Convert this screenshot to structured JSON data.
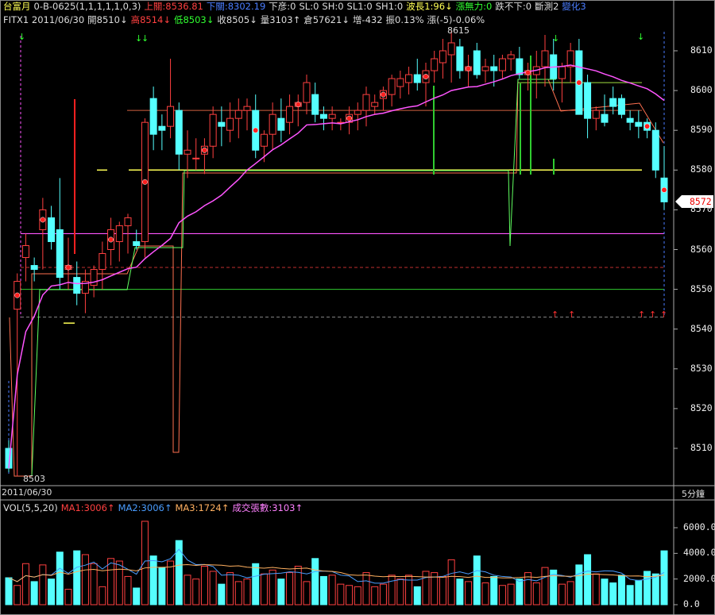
{
  "header": {
    "row1": [
      {
        "text": "台富月",
        "color": "#ffff55"
      },
      {
        "text": "0-B-0625(1,1,1,1,1,0,3)",
        "color": "#dddddd"
      },
      {
        "text": "上關:8536.81",
        "color": "#ff4040"
      },
      {
        "text": "下關:8302.19",
        "color": "#4a7dff"
      },
      {
        "text": "下彦:0",
        "color": "#dddddd"
      },
      {
        "text": "SL:0",
        "color": "#dddddd"
      },
      {
        "text": "SH:0",
        "color": "#dddddd"
      },
      {
        "text": "SL1:0",
        "color": "#dddddd"
      },
      {
        "text": "SH1:0",
        "color": "#dddddd"
      },
      {
        "text": "波長1:96↓",
        "color": "#ffff55"
      },
      {
        "text": "漲無力:0",
        "color": "#30ff30"
      },
      {
        "text": "跌不下:0",
        "color": "#dddddd"
      },
      {
        "text": "斷測2",
        "color": "#dddddd"
      },
      {
        "text": "變化3",
        "color": "#4a7dff"
      }
    ],
    "row2": [
      {
        "text": "FITX1 2011/06/30",
        "color": "#dddddd"
      },
      {
        "text": "開8510↓",
        "color": "#dddddd"
      },
      {
        "text": "高8514↓",
        "color": "#ff4040"
      },
      {
        "text": "低8503↓",
        "color": "#30ff30"
      },
      {
        "text": "收8505↓",
        "color": "#dddddd"
      },
      {
        "text": "量3103↑",
        "color": "#dddddd"
      },
      {
        "text": "倉57621↓",
        "color": "#dddddd"
      },
      {
        "text": "增-432",
        "color": "#dddddd"
      },
      {
        "text": "振0.13%",
        "color": "#dddddd"
      },
      {
        "text": "漲(-5)-0.06%",
        "color": "#dddddd"
      }
    ]
  },
  "date_label": "2011/06/30",
  "timeframe_label": "5分鐘",
  "last_price_label": "8572",
  "annotations": {
    "high": "8615",
    "low": "8503"
  },
  "volume_header": [
    {
      "text": "VOL(5,5,20)",
      "color": "#dddddd"
    },
    {
      "text": "MA1:3006↑",
      "color": "#ff4040"
    },
    {
      "text": "MA2:3006↑",
      "color": "#4a9dff"
    },
    {
      "text": "MA3:1724↑",
      "color": "#ffb060"
    },
    {
      "text": "成交張數:3103↑",
      "color": "#ff80ff"
    }
  ],
  "chart_data": {
    "type": "candlestick",
    "price_axis": {
      "min": 8503,
      "max": 8615,
      "ticks": [
        8510,
        8520,
        8530,
        8540,
        8550,
        8560,
        8570,
        8580,
        8590,
        8600,
        8610
      ]
    },
    "volume_axis": {
      "max": 6000,
      "ticks": [
        "0.0",
        "2000.0",
        "4000.0",
        "6000.0"
      ]
    },
    "candles": [
      {
        "o": 8510,
        "h": 8512,
        "l": 8504,
        "c": 8505,
        "v": 2100
      },
      {
        "o": 8545,
        "h": 8554,
        "l": 8503,
        "c": 8552,
        "v": 1500
      },
      {
        "o": 8558,
        "h": 8564,
        "l": 8552,
        "c": 8561,
        "v": 3200
      },
      {
        "o": 8556,
        "h": 8558,
        "l": 8552,
        "c": 8555,
        "v": 1800
      },
      {
        "o": 8565,
        "h": 8573,
        "l": 8555,
        "c": 8570,
        "v": 3100
      },
      {
        "o": 8568,
        "h": 8571,
        "l": 8560,
        "c": 8562,
        "v": 2000
      },
      {
        "o": 8565,
        "h": 8578,
        "l": 8550,
        "c": 8553,
        "v": 4100
      },
      {
        "o": 8555,
        "h": 8563,
        "l": 8550,
        "c": 8556,
        "v": 1200
      },
      {
        "o": 8553,
        "h": 8557,
        "l": 8546,
        "c": 8549,
        "v": 4200
      },
      {
        "o": 8549,
        "h": 8555,
        "l": 8544,
        "c": 8552,
        "v": 3900
      },
      {
        "o": 8551,
        "h": 8556,
        "l": 8548,
        "c": 8555,
        "v": 3200
      },
      {
        "o": 8555,
        "h": 8562,
        "l": 8550,
        "c": 8559,
        "v": 1400
      },
      {
        "o": 8560,
        "h": 8568,
        "l": 8556,
        "c": 8565,
        "v": 3600
      },
      {
        "o": 8562,
        "h": 8567,
        "l": 8557,
        "c": 8566,
        "v": 3400
      },
      {
        "o": 8566,
        "h": 8569,
        "l": 8559,
        "c": 8568,
        "v": 2200
      },
      {
        "o": 8562,
        "h": 8565,
        "l": 8560,
        "c": 8561,
        "v": 1300
      },
      {
        "o": 8562,
        "h": 8593,
        "l": 8558,
        "c": 8592,
        "v": 6500
      },
      {
        "o": 8598,
        "h": 8601,
        "l": 8585,
        "c": 8589,
        "v": 3800
      },
      {
        "o": 8591,
        "h": 8594,
        "l": 8585,
        "c": 8590,
        "v": 2900
      },
      {
        "o": 8591,
        "h": 8608,
        "l": 8588,
        "c": 8596,
        "v": 3400
      },
      {
        "o": 8595,
        "h": 8597,
        "l": 8580,
        "c": 8584,
        "v": 5000
      },
      {
        "o": 8584,
        "h": 8590,
        "l": 8578,
        "c": 8585,
        "v": 2300
      },
      {
        "o": 8583,
        "h": 8588,
        "l": 8580,
        "c": 8583,
        "v": 2000
      },
      {
        "o": 8584,
        "h": 8588,
        "l": 8579,
        "c": 8586,
        "v": 3000
      },
      {
        "o": 8586,
        "h": 8596,
        "l": 8583,
        "c": 8594,
        "v": 2600
      },
      {
        "o": 8592,
        "h": 8596,
        "l": 8586,
        "c": 8591,
        "v": 1600
      },
      {
        "o": 8590,
        "h": 8597,
        "l": 8587,
        "c": 8593,
        "v": 2500
      },
      {
        "o": 8593,
        "h": 8598,
        "l": 8588,
        "c": 8595,
        "v": 1800
      },
      {
        "o": 8595,
        "h": 8598,
        "l": 8590,
        "c": 8596,
        "v": 2000
      },
      {
        "o": 8595,
        "h": 8599,
        "l": 8583,
        "c": 8585,
        "v": 3200
      },
      {
        "o": 8586,
        "h": 8590,
        "l": 8582,
        "c": 8589,
        "v": 2400
      },
      {
        "o": 8589,
        "h": 8597,
        "l": 8585,
        "c": 8594,
        "v": 2700
      },
      {
        "o": 8593,
        "h": 8598,
        "l": 8587,
        "c": 8590,
        "v": 2000
      },
      {
        "o": 8592,
        "h": 8599,
        "l": 8589,
        "c": 8596,
        "v": 2500
      },
      {
        "o": 8596,
        "h": 8599,
        "l": 8591,
        "c": 8597,
        "v": 3000
      },
      {
        "o": 8597,
        "h": 8604,
        "l": 8594,
        "c": 8602,
        "v": 1800
      },
      {
        "o": 8599,
        "h": 8602,
        "l": 8592,
        "c": 8594,
        "v": 3600
      },
      {
        "o": 8594,
        "h": 8596,
        "l": 8590,
        "c": 8593,
        "v": 2200
      },
      {
        "o": 8593,
        "h": 8596,
        "l": 8590,
        "c": 8594,
        "v": 2300
      },
      {
        "o": 8592,
        "h": 8593,
        "l": 8590,
        "c": 8592,
        "v": 1600
      },
      {
        "o": 8592,
        "h": 8596,
        "l": 8589,
        "c": 8594,
        "v": 1500
      },
      {
        "o": 8594,
        "h": 8597,
        "l": 8590,
        "c": 8595,
        "v": 1400
      },
      {
        "o": 8595,
        "h": 8601,
        "l": 8591,
        "c": 8599,
        "v": 2500
      },
      {
        "o": 8596,
        "h": 8599,
        "l": 8594,
        "c": 8597,
        "v": 1400
      },
      {
        "o": 8598,
        "h": 8601,
        "l": 8595,
        "c": 8600,
        "v": 1600
      },
      {
        "o": 8599,
        "h": 8604,
        "l": 8596,
        "c": 8603,
        "v": 2300
      },
      {
        "o": 8601,
        "h": 8605,
        "l": 8598,
        "c": 8603,
        "v": 2000
      },
      {
        "o": 8602,
        "h": 8606,
        "l": 8599,
        "c": 8604,
        "v": 2300
      },
      {
        "o": 8604,
        "h": 8608,
        "l": 8600,
        "c": 8602,
        "v": 1400
      },
      {
        "o": 8602,
        "h": 8607,
        "l": 8596,
        "c": 8605,
        "v": 2600
      },
      {
        "o": 8605,
        "h": 8610,
        "l": 8602,
        "c": 8608,
        "v": 2500
      },
      {
        "o": 8607,
        "h": 8613,
        "l": 8603,
        "c": 8610,
        "v": 2200
      },
      {
        "o": 8609,
        "h": 8615,
        "l": 8602,
        "c": 8612,
        "v": 3500
      },
      {
        "o": 8611,
        "h": 8613,
        "l": 8603,
        "c": 8605,
        "v": 2000
      },
      {
        "o": 8605,
        "h": 8609,
        "l": 8601,
        "c": 8606,
        "v": 1800
      },
      {
        "o": 8610,
        "h": 8612,
        "l": 8603,
        "c": 8604,
        "v": 3800
      },
      {
        "o": 8605,
        "h": 8608,
        "l": 8602,
        "c": 8606,
        "v": 1700
      },
      {
        "o": 8606,
        "h": 8609,
        "l": 8601,
        "c": 8605,
        "v": 2200
      },
      {
        "o": 8605,
        "h": 8609,
        "l": 8603,
        "c": 8608,
        "v": 1500
      },
      {
        "o": 8608,
        "h": 8610,
        "l": 8605,
        "c": 8609,
        "v": 1600
      },
      {
        "o": 8608,
        "h": 8611,
        "l": 8603,
        "c": 8604,
        "v": 2000
      },
      {
        "o": 8604,
        "h": 8607,
        "l": 8600,
        "c": 8605,
        "v": 2500
      },
      {
        "o": 8604,
        "h": 8610,
        "l": 8598,
        "c": 8606,
        "v": 1700
      },
      {
        "o": 8606,
        "h": 8614,
        "l": 8601,
        "c": 8610,
        "v": 2900
      },
      {
        "o": 8609,
        "h": 8613,
        "l": 8600,
        "c": 8603,
        "v": 2700
      },
      {
        "o": 8603,
        "h": 8607,
        "l": 8597,
        "c": 8606,
        "v": 1600
      },
      {
        "o": 8606,
        "h": 8612,
        "l": 8602,
        "c": 8610,
        "v": 1800
      },
      {
        "o": 8610,
        "h": 8613,
        "l": 8600,
        "c": 8594,
        "v": 3100
      },
      {
        "o": 8602,
        "h": 8604,
        "l": 8588,
        "c": 8593,
        "v": 3900
      },
      {
        "o": 8593,
        "h": 8596,
        "l": 8590,
        "c": 8595,
        "v": 2400
      },
      {
        "o": 8594,
        "h": 8599,
        "l": 8591,
        "c": 8592,
        "v": 2000
      },
      {
        "o": 8598,
        "h": 8601,
        "l": 8594,
        "c": 8596,
        "v": 1700
      },
      {
        "o": 8598,
        "h": 8599,
        "l": 8593,
        "c": 8594,
        "v": 2300
      },
      {
        "o": 8593,
        "h": 8595,
        "l": 8590,
        "c": 8592,
        "v": 1500
      },
      {
        "o": 8592,
        "h": 8595,
        "l": 8588,
        "c": 8591,
        "v": 1900
      },
      {
        "o": 8592,
        "h": 8593,
        "l": 8588,
        "c": 8590,
        "v": 2600
      },
      {
        "o": 8590,
        "h": 8592,
        "l": 8578,
        "c": 8580,
        "v": 2400
      },
      {
        "o": 8578,
        "h": 8586,
        "l": 8570,
        "c": 8572,
        "v": 4200
      }
    ],
    "volume_ma_note": "MA lines overlayed on volume panel"
  },
  "colors": {
    "up": "#000000",
    "up_border": "#ff4040",
    "down": "#55ffff",
    "grid": "#333333",
    "ma": "#ff55ff",
    "hline_yellow": "#ffff55",
    "hline_green": "#30ff30",
    "stair_orange": "#ff7050",
    "stair_green": "#60ff60"
  }
}
